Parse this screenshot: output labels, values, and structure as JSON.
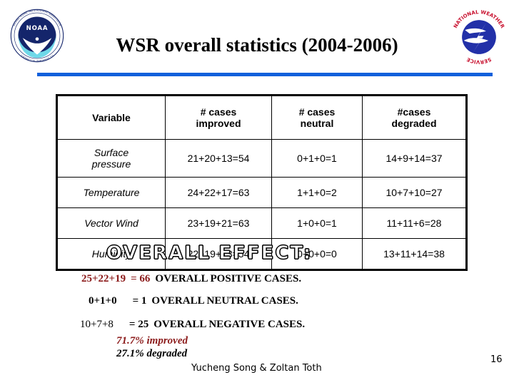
{
  "slide": {
    "title": "WSR overall statistics (2004-2006)",
    "page_number": "16",
    "authors": "Yucheng Song & Zoltan Toth",
    "accent_color": "#1060dc",
    "highlight_color": "#8b1a1a"
  },
  "logos": {
    "left": {
      "name": "noaa-logo",
      "text": "NOAA"
    },
    "right": {
      "name": "nws-logo",
      "text": "NATIONAL WEATHER SERVICE"
    }
  },
  "table": {
    "headers": [
      "Variable",
      "# cases\nimproved",
      "# cases\nneutral",
      "#cases\ndegraded"
    ],
    "headers_line1": [
      "Variable",
      "# cases",
      "# cases",
      "#cases"
    ],
    "headers_line2": [
      "",
      "improved",
      "neutral",
      "degraded"
    ],
    "rows": [
      {
        "variable_line1": "Surface",
        "variable_line2": "pressure",
        "improved": "21+20+13=54",
        "neutral": "0+1+0=1",
        "degraded": "14+9+14=37"
      },
      {
        "variable_line1": "Temperature",
        "variable_line2": "",
        "improved": "24+22+17=63",
        "neutral": "1+1+0=2",
        "degraded": "10+7+10=27"
      },
      {
        "variable_line1": "Vector Wind",
        "variable_line2": "",
        "improved": "23+19+21=63",
        "neutral": "1+0+0=1",
        "degraded": "11+11+6=28"
      },
      {
        "variable_line1": "Humidity",
        "variable_line2": "",
        "improved": "22+19+13=54",
        "neutral": "0+0+0=0",
        "degraded": "13+11+14=38"
      }
    ]
  },
  "overall": {
    "heading": "OVERALL EFFECT:",
    "positive": {
      "sum": "25+22+19",
      "equals": "= 66",
      "label": "OVERALL POSITIVE CASES."
    },
    "neutral": {
      "sum": "0+1+0",
      "equals": "= 1",
      "label": "OVERALL NEUTRAL CASES."
    },
    "negative": {
      "sum": "10+7+8",
      "equals": "= 25",
      "label": "OVERALL NEGATIVE CASES."
    },
    "pct_improved": "71.7% improved",
    "pct_degraded": "27.1% degraded"
  }
}
